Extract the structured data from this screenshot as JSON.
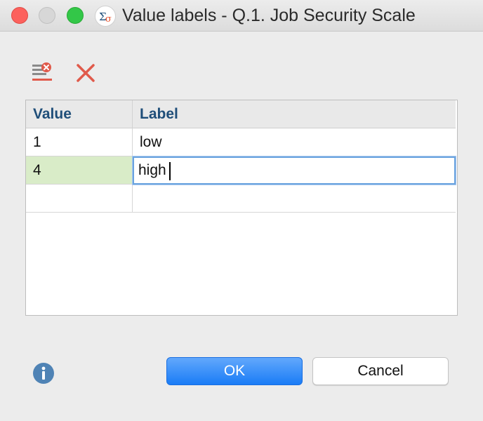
{
  "window": {
    "title": "Value labels - Q.1. Job Security Scale",
    "app_icon": "sigma-icon"
  },
  "toolbar": {
    "clear_icon": "clear-list-icon",
    "delete_icon": "delete-x-icon"
  },
  "table": {
    "headers": [
      "Value",
      "Label"
    ],
    "rows": [
      {
        "value": "1",
        "label": "low"
      },
      {
        "value": "4",
        "label": "high"
      },
      {
        "value": "",
        "label": ""
      }
    ],
    "editing_value": "high",
    "header_color": "#1f4e79",
    "selected_cell_color": "#d9ecc8"
  },
  "footer": {
    "info_icon": "info-icon",
    "ok_label": "OK",
    "cancel_label": "Cancel",
    "accent": "#1a7cf6"
  }
}
